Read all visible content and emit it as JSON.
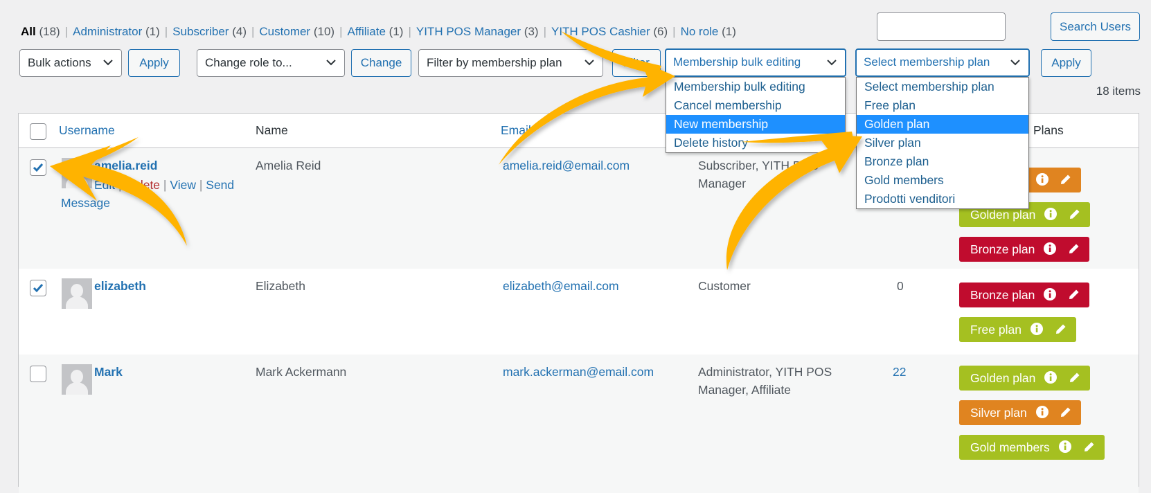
{
  "role_filters": [
    {
      "label": "All",
      "count": "(18)",
      "current": true
    },
    {
      "label": "Administrator",
      "count": "(1)"
    },
    {
      "label": "Subscriber",
      "count": "(4)"
    },
    {
      "label": "Customer",
      "count": "(10)"
    },
    {
      "label": "Affiliate",
      "count": "(1)"
    },
    {
      "label": "YITH POS Manager",
      "count": "(3)"
    },
    {
      "label": "YITH POS Cashier",
      "count": "(6)"
    },
    {
      "label": "No role",
      "count": "(1)"
    }
  ],
  "search": {
    "value": "",
    "button": "Search Users"
  },
  "toolbar": {
    "bulk_actions": "Bulk actions",
    "apply": "Apply",
    "change_role": "Change role to...",
    "change": "Change",
    "filter_plan": "Filter by membership plan",
    "filter": "Filter",
    "membership_bulk": "Membership bulk editing",
    "select_plan": "Select membership plan",
    "apply2": "Apply"
  },
  "items_count": "18 items",
  "bulk_dropdown": {
    "options": [
      "Membership bulk editing",
      "Cancel membership",
      "New membership",
      "Delete history"
    ],
    "selected": "New membership"
  },
  "plan_dropdown": {
    "options": [
      "Select membership plan",
      "Free plan",
      "Golden plan",
      "Silver plan",
      "Bronze plan",
      "Gold members",
      "Prodotti venditori"
    ],
    "selected": "Golden plan"
  },
  "table": {
    "headers": {
      "username": "Username",
      "name": "Name",
      "email": "Email",
      "plans": "Plans"
    },
    "rows": [
      {
        "username": "amelia.reid",
        "name": "Amelia Reid",
        "email": "amelia.reid@email.com",
        "role_line1": "Subscriber, YITH POS",
        "role_line2": "Manager",
        "posts": "",
        "checked": true,
        "actions": {
          "edit": "Edit",
          "delete": "Delete",
          "view": "View",
          "send": "Send",
          "message": "Message"
        },
        "plans": [
          {
            "label": "Silver plan",
            "color": "#e08420"
          },
          {
            "label": "Golden plan",
            "color": "#a5c021"
          },
          {
            "label": "Bronze plan",
            "color": "#c00c2e"
          }
        ]
      },
      {
        "username": "elizabeth",
        "name": "Elizabeth",
        "email": "elizabeth@email.com",
        "role_line1": "Customer",
        "role_line2": "",
        "posts": "0",
        "checked": true,
        "plans": [
          {
            "label": "Bronze plan",
            "color": "#c00c2e"
          },
          {
            "label": "Free plan",
            "color": "#a5c021"
          }
        ]
      },
      {
        "username": "Mark",
        "name": "Mark Ackermann",
        "email": "mark.ackerman@email.com",
        "role_line1": "Administrator, YITH POS",
        "role_line2": "Manager, Affiliate",
        "posts": "22",
        "checked": false,
        "plans": [
          {
            "label": "Golden plan",
            "color": "#a5c021"
          },
          {
            "label": "Silver plan",
            "color": "#e08420"
          },
          {
            "label": "Gold members",
            "color": "#a5c021"
          }
        ]
      }
    ]
  },
  "colors": {
    "accent": "#2271b1",
    "highlight": "#1e90ff",
    "arrow": "#ffb300"
  }
}
